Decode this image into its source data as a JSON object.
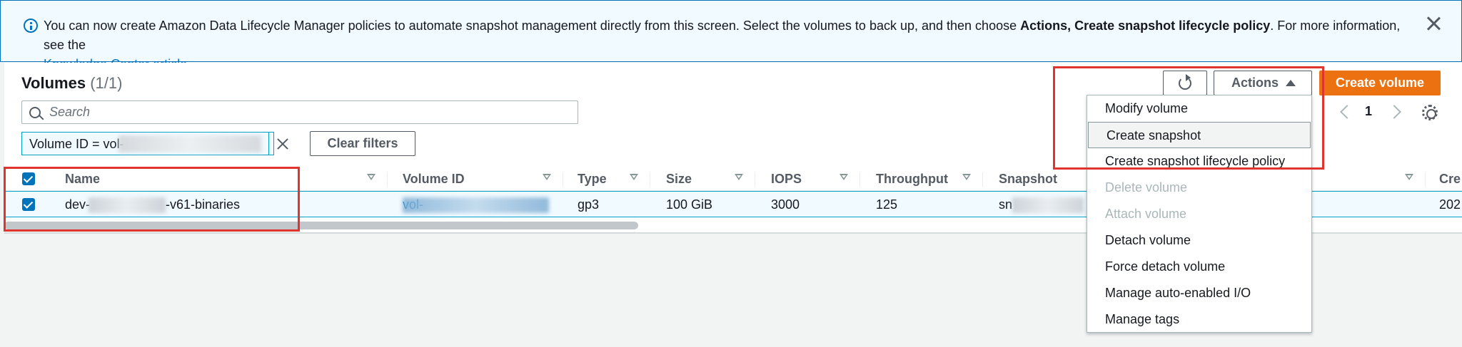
{
  "flash": {
    "text_1": "You can now create Amazon Data Lifecycle Manager policies to automate snapshot management directly from this screen. Select the volumes to back up, and then choose ",
    "text_bold": "Actions, Create snapshot lifecycle policy",
    "text_2": ". For more information, see the",
    "link": "Knowledge Center article."
  },
  "header": {
    "title": "Volumes",
    "count": "(1/1)"
  },
  "search": {
    "placeholder": "Search"
  },
  "filter": {
    "token_label": "Volume ID = vol-",
    "clear_label": "Clear filters"
  },
  "toolbar": {
    "actions_label": "Actions",
    "create_label": "Create volume"
  },
  "pagination": {
    "current_page": "1"
  },
  "table": {
    "columns": [
      "Name",
      "Volume ID",
      "Type",
      "Size",
      "IOPS",
      "Throughput",
      "Snapshot",
      "Cre"
    ],
    "row": {
      "name_prefix": "dev-",
      "name_suffix": "-v61-binaries",
      "volume_id": "vol-",
      "type": "gp3",
      "size": "100 GiB",
      "iops": "3000",
      "throughput": "125",
      "snapshot": "sn",
      "created": "202"
    }
  },
  "actions_menu": {
    "items": [
      {
        "label": "Modify volume",
        "enabled": true
      },
      {
        "label": "Create snapshot",
        "enabled": true
      },
      {
        "label": "Create snapshot lifecycle policy",
        "enabled": true
      },
      {
        "label": "Delete volume",
        "enabled": false
      },
      {
        "label": "Attach volume",
        "enabled": false
      },
      {
        "label": "Detach volume",
        "enabled": true
      },
      {
        "label": "Force detach volume",
        "enabled": true
      },
      {
        "label": "Manage auto-enabled I/O",
        "enabled": true
      },
      {
        "label": "Manage tags",
        "enabled": true
      }
    ]
  },
  "colors": {
    "accent": "#0073bb",
    "primary_button": "#ec7211",
    "annotation": "#e0342f",
    "disabled_text": "#aab7b8"
  },
  "icons": [
    "info-icon",
    "close-icon",
    "search-icon",
    "refresh-icon",
    "caret-up-icon",
    "chevron-left-icon",
    "chevron-right-icon",
    "gear-icon",
    "sort-icon",
    "checkbox-checked-icon"
  ]
}
